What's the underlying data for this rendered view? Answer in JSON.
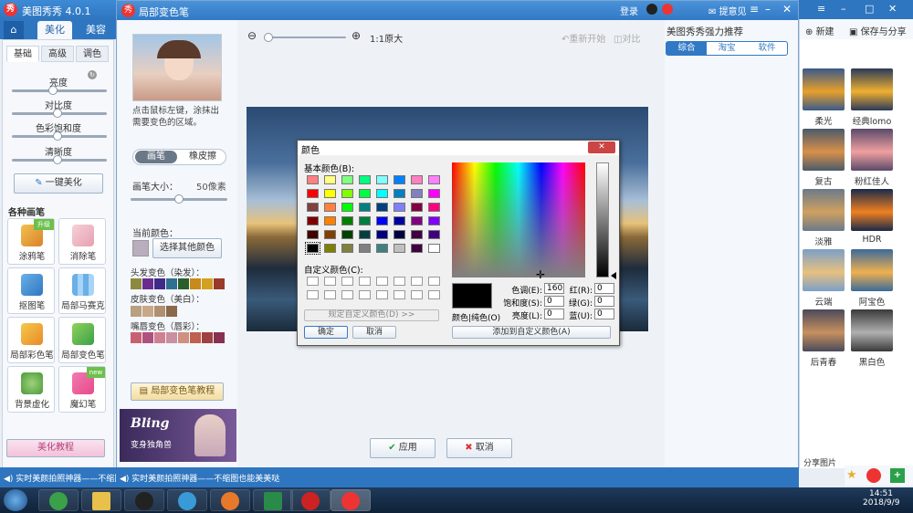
{
  "app": {
    "title": "美图秀秀 4.0.1",
    "tabs": [
      "美化",
      "美容"
    ],
    "login": "登录",
    "feedback": "提意见",
    "new_label": "新建",
    "save_share": "保存与分享"
  },
  "sidepanel": {
    "subtabs": [
      "基础",
      "高级",
      "调色"
    ],
    "sliders": [
      {
        "label": "亮度",
        "value": 0.4
      },
      {
        "label": "对比度",
        "value": 0.45
      },
      {
        "label": "色彩饱和度",
        "value": 0.45
      },
      {
        "label": "清晰度",
        "value": 0.45
      }
    ],
    "one_click": "一键美化",
    "brush_section": "各种画笔",
    "tools": [
      "涂鸦笔",
      "消除笔",
      "抠图笔",
      "局部马赛克",
      "局部彩色笔",
      "局部变色笔",
      "背景虚化",
      "魔幻笔"
    ],
    "tutorial": "美化教程",
    "badges": {
      "upgrade": "升级",
      "new": "new"
    }
  },
  "status_bar": {
    "left": "实时美颜拍照神器——不缩图",
    "right": "实时美颜拍照神器——不缩图也能美美哒"
  },
  "dialog": {
    "title": "局部变色笔",
    "hint": "点击鼠标左键，涂抹出需要变色的区域。",
    "modes": [
      "画笔",
      "橡皮擦"
    ],
    "brush_size_label": "画笔大小：",
    "brush_size_value": "50像素",
    "brush_size_level": 0.5,
    "current_color_label": "当前颜色：",
    "choose_color": "选择其他颜色",
    "hair_label": "头发变色（染发）：",
    "skin_label": "皮肤变色（美白）：",
    "lip_label": "嘴唇变色（唇彩）：",
    "hair_colors": [
      "#8b8a3f",
      "#6a2b8f",
      "#3f2a8a",
      "#2f6f8f",
      "#2a5f2a",
      "#c98a1a",
      "#d4a020",
      "#9a3a2a"
    ],
    "skin_colors": [
      "#b8a080",
      "#c8a888",
      "#b09070",
      "#8a6a4a"
    ],
    "lip_colors": [
      "#c86070",
      "#b05080",
      "#d08090",
      "#c890a0",
      "#d09080",
      "#c06050",
      "#a04040",
      "#883050"
    ],
    "tutorial_btn": "局部变色笔教程",
    "ad_title": "Bling",
    "ad_sub": "变身独角兽",
    "zoom_label": "1:1原大",
    "reset": "重新开始",
    "compare": "对比",
    "apply": "应用",
    "cancel": "取消",
    "recommend_title": "美图秀秀强力推荐",
    "recommend_tabs": [
      "综合",
      "淘宝",
      "软件"
    ]
  },
  "color_dialog": {
    "title": "颜色",
    "basic_label": "基本颜色(B):",
    "custom_label": "自定义颜色(C):",
    "define_custom": "规定自定义颜色(D) >>",
    "ok": "确定",
    "cancel": "取消",
    "solid_label": "颜色|纯色(O)",
    "add_custom": "添加到自定义颜色(A)",
    "fields": [
      {
        "label": "色调(E):",
        "value": "160"
      },
      {
        "label": "饱和度(S):",
        "value": "0"
      },
      {
        "label": "亮度(L):",
        "value": "0"
      }
    ],
    "rgb": [
      {
        "label": "红(R):",
        "value": "0"
      },
      {
        "label": "绿(G):",
        "value": "0"
      },
      {
        "label": "蓝(U):",
        "value": "0"
      }
    ],
    "basic_colors": [
      "#ff8080",
      "#ffff80",
      "#80ff80",
      "#00ff80",
      "#80ffff",
      "#0080ff",
      "#ff80c0",
      "#ff80ff",
      "#ff0000",
      "#ffff00",
      "#80ff00",
      "#00ff40",
      "#00ffff",
      "#0080c0",
      "#8080c0",
      "#ff00ff",
      "#804040",
      "#ff8040",
      "#00ff00",
      "#008080",
      "#004080",
      "#8080ff",
      "#800040",
      "#ff0080",
      "#800000",
      "#ff8000",
      "#008000",
      "#008040",
      "#0000ff",
      "#0000a0",
      "#800080",
      "#8000ff",
      "#400000",
      "#804000",
      "#004000",
      "#004040",
      "#000080",
      "#000040",
      "#400040",
      "#400080",
      "#000000",
      "#808000",
      "#808040",
      "#808080",
      "#408080",
      "#c0c0c0",
      "#400040",
      "#ffffff"
    ]
  },
  "effects": {
    "items": [
      "柔光",
      "经典lomo",
      "复古",
      "粉红佳人",
      "淡雅",
      "HDR",
      "云端",
      "阿宝色",
      "后青春",
      "黑白色"
    ],
    "share": "分享图片"
  },
  "taskbar": {
    "time": "14:51",
    "date": "2018/9/9"
  }
}
